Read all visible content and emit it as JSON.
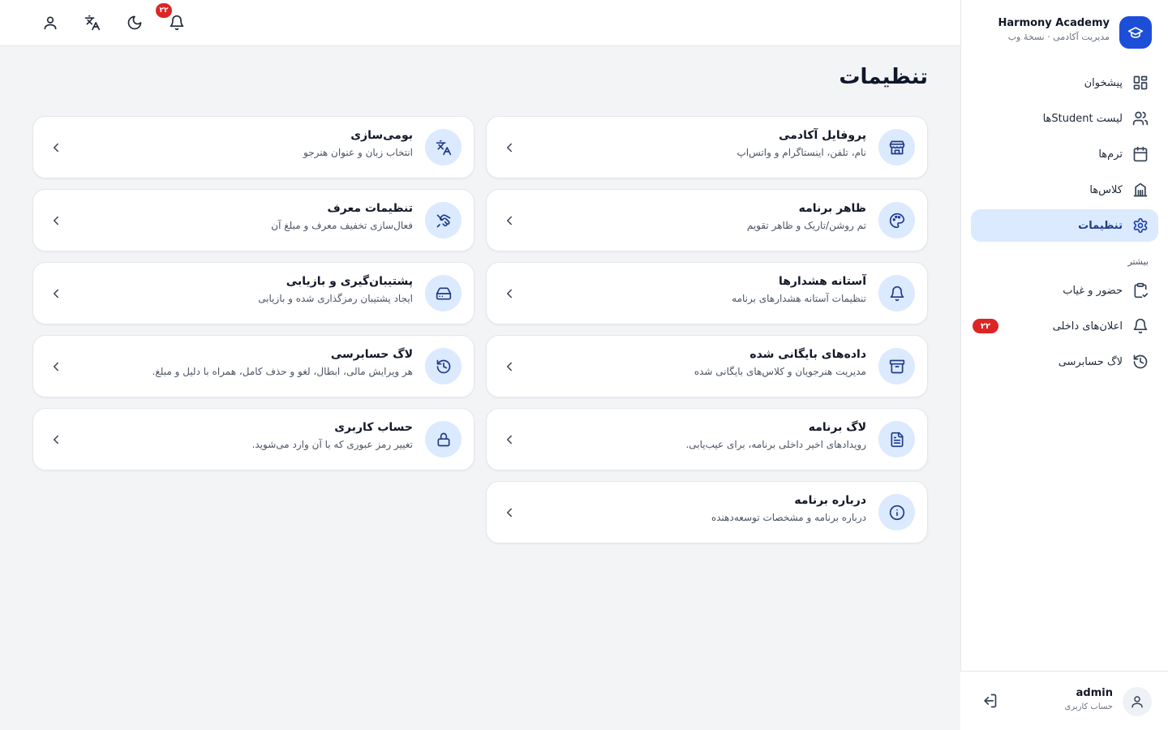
{
  "brand": {
    "name": "Harmony Academy",
    "subtitle": "مدیریت آکادمی · نسخهٔ وب",
    "logo_icon": "graduation-cap-icon"
  },
  "sidebar": {
    "items": [
      {
        "label": "پیشخوان",
        "icon": "dashboard-icon",
        "active": false
      },
      {
        "label": "لیست Studentها",
        "icon": "users-icon",
        "active": false
      },
      {
        "label": "ترم‌ها",
        "icon": "calendar-icon",
        "active": false
      },
      {
        "label": "کلاس‌ها",
        "icon": "building-icon",
        "active": false
      },
      {
        "label": "تنظیمات",
        "icon": "settings-icon",
        "active": true
      }
    ],
    "more_section": "بیشتر",
    "more_items": [
      {
        "label": "حضور و غیاب",
        "icon": "clipboard-icon"
      },
      {
        "label": "اعلان‌های داخلی",
        "icon": "bell-icon",
        "badge": "۲۲"
      },
      {
        "label": "لاگ حسابرسی",
        "icon": "history-icon"
      }
    ]
  },
  "user": {
    "name": "admin",
    "role": "حساب کاربری"
  },
  "topbar": {
    "notification_count": "۲۲"
  },
  "page": {
    "title": "تنظیمات"
  },
  "cards": [
    {
      "title": "پروفایل آکادمی",
      "subtitle": "نام، تلفن، اینستاگرام و واتس‌اپ",
      "icon": "store-icon"
    },
    {
      "title": "بومی‌سازی",
      "subtitle": "انتخاب زبان و عنوان هنرجو",
      "icon": "translate-icon"
    },
    {
      "title": "ظاهر برنامه",
      "subtitle": "تم روشن/تاریک و ظاهر تقویم",
      "icon": "palette-icon"
    },
    {
      "title": "تنظیمات معرف",
      "subtitle": "فعال‌سازی تخفیف معرف و مبلغ آن",
      "icon": "handshake-icon"
    },
    {
      "title": "آستانه هشدارها",
      "subtitle": "تنظیمات آستانه هشدارهای برنامه",
      "icon": "bell-icon"
    },
    {
      "title": "پشتیبان‌گیری و بازیابی",
      "subtitle": "ایجاد پشتیبان رمزگذاری شده و بازیابی",
      "icon": "hard-drive-icon"
    },
    {
      "title": "داده‌های بایگانی شده",
      "subtitle": "مدیریت هنرجویان و کلاس‌های بایگانی شده",
      "icon": "archive-icon"
    },
    {
      "title": "لاگ حسابرسی",
      "subtitle": "هر ویرایش مالی، ابطال، لغو و حذف کامل، همراه با دلیل و مبلغ.",
      "icon": "history-icon"
    },
    {
      "title": "لاگ برنامه",
      "subtitle": "رویدادهای اخیر داخلی برنامه، برای عیب‌یابی.",
      "icon": "file-text-icon"
    },
    {
      "title": "حساب کاربری",
      "subtitle": "تغییر رمز عبوری که با آن وارد می‌شوید.",
      "icon": "lock-icon"
    },
    {
      "title": "درباره برنامه",
      "subtitle": "درباره برنامه و مشخصات توسعه‌دهنده",
      "icon": "info-icon"
    }
  ],
  "colors": {
    "accent": "#1d4ed8",
    "accent_soft": "#dbeafe",
    "badge": "#dc2626",
    "background": "#f3f4f6"
  }
}
